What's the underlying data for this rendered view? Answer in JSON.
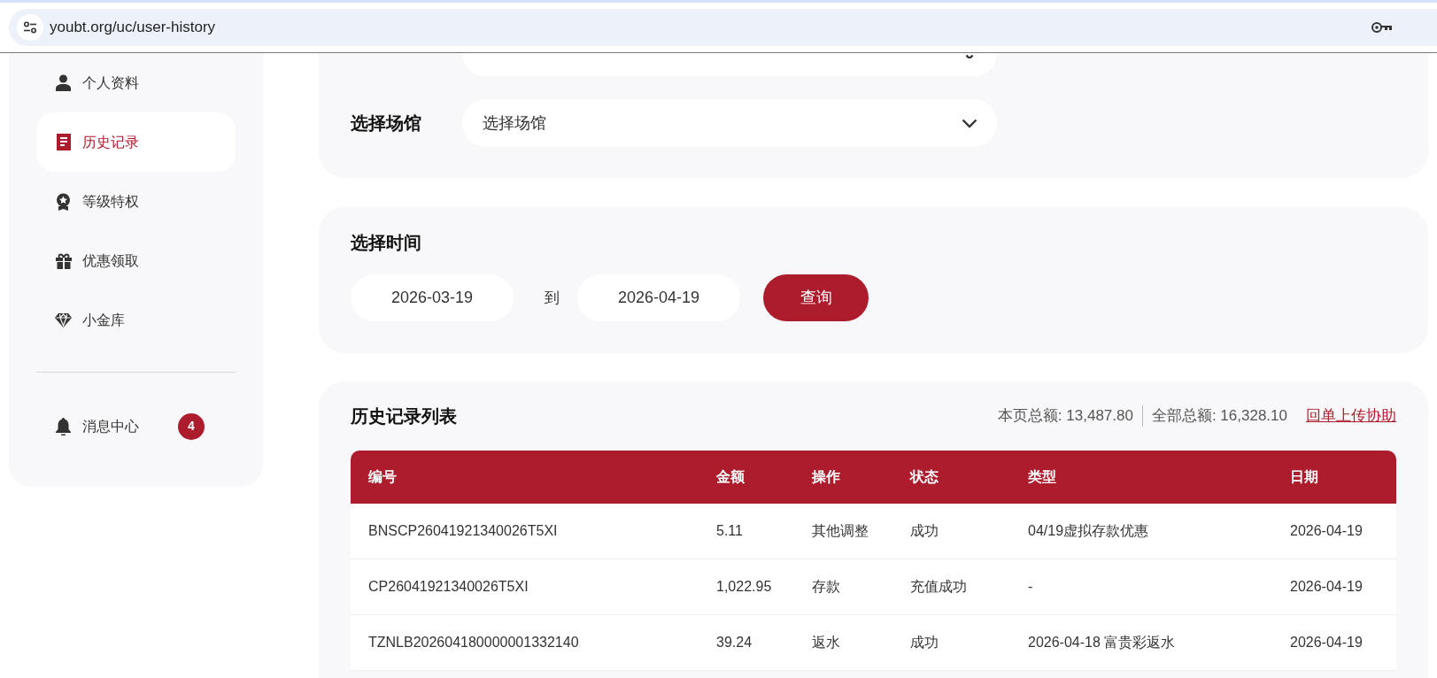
{
  "browser": {
    "url": "youbt.org/uc/user-history"
  },
  "sidebar": {
    "items": [
      {
        "label": "个人资料",
        "selected": false
      },
      {
        "label": "历史记录",
        "selected": true
      },
      {
        "label": "等级特权",
        "selected": false
      },
      {
        "label": "优惠领取",
        "selected": false
      },
      {
        "label": "小金库",
        "selected": false
      }
    ],
    "messages": {
      "label": "消息中心",
      "badge": "4"
    }
  },
  "filters": [
    {
      "label": "选择场馆",
      "value": "选择场馆"
    }
  ],
  "time": {
    "title": "选择时间",
    "from": "2026-03-19",
    "separator": "到",
    "to": "2026-04-19",
    "button": "查询"
  },
  "history": {
    "title": "历史记录列表",
    "page_total": "本页总额: 13,487.80",
    "all_total": "全部总额: 16,328.10",
    "link": "回单上传协助",
    "columns": [
      "编号",
      "金额",
      "操作",
      "状态",
      "类型",
      "日期"
    ],
    "rows": [
      [
        "BNSCP26041921340026T5XI",
        "5.11",
        "其他调整",
        "成功",
        "04/19虚拟存款优惠",
        "2026-04-19"
      ],
      [
        "CP26041921340026T5XI",
        "1,022.95",
        "存款",
        "充值成功",
        "-",
        "2026-04-19"
      ],
      [
        "TZNLB202604180000001332140",
        "39.24",
        "返水",
        "成功",
        "2026-04-18 富贵彩返水",
        "2026-04-19"
      ]
    ]
  }
}
